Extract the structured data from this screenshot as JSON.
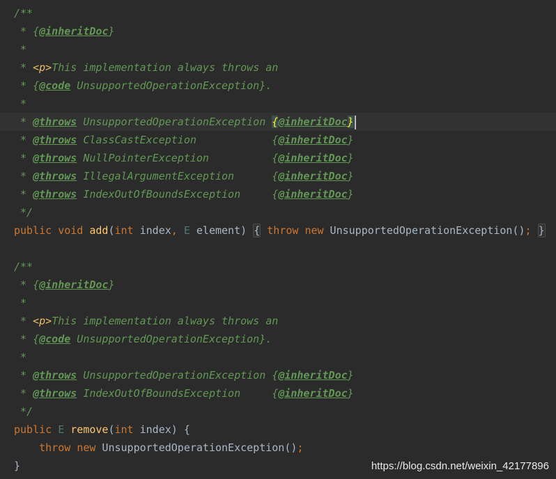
{
  "watermark": "https://blog.csdn.net/weixin_42177896",
  "code": {
    "l1": "/**",
    "l2": [
      " * {",
      "@inheritDoc",
      "}"
    ],
    "l3": " *",
    "l4": [
      " * ",
      "<p>",
      "This implementation always throws an"
    ],
    "l5": [
      " * {",
      "@code",
      " UnsupportedOperationException}."
    ],
    "l6": " *",
    "l7": [
      " * ",
      "@throws",
      " UnsupportedOperationException ",
      "{",
      "@inheritDoc",
      "}"
    ],
    "l8": [
      " * ",
      "@throws",
      " ClassCastException            {",
      "@inheritDoc",
      "}"
    ],
    "l9": [
      " * ",
      "@throws",
      " NullPointerException          {",
      "@inheritDoc",
      "}"
    ],
    "l10": [
      " * ",
      "@throws",
      " IllegalArgumentException      {",
      "@inheritDoc",
      "}"
    ],
    "l11": [
      " * ",
      "@throws",
      " IndexOutOfBoundsException     {",
      "@inheritDoc",
      "}"
    ],
    "l12": " */",
    "l13": [
      "public",
      " ",
      "void",
      " ",
      "add",
      "(",
      "int",
      " index",
      ",",
      " ",
      "E",
      " element)",
      " ",
      "{",
      " ",
      "throw",
      " ",
      "new",
      " UnsupportedOperationException()",
      ";",
      " ",
      "}"
    ],
    "l14": "",
    "l15": "/**",
    "l16": [
      " * {",
      "@inheritDoc",
      "}"
    ],
    "l17": " *",
    "l18": [
      " * ",
      "<p>",
      "This implementation always throws an"
    ],
    "l19": [
      " * {",
      "@code",
      " UnsupportedOperationException}."
    ],
    "l20": " *",
    "l21": [
      " * ",
      "@throws",
      " UnsupportedOperationException {",
      "@inheritDoc",
      "}"
    ],
    "l22": [
      " * ",
      "@throws",
      " IndexOutOfBoundsException     {",
      "@inheritDoc",
      "}"
    ],
    "l23": " */",
    "l24": [
      "public",
      " ",
      "E",
      " ",
      "remove",
      "(",
      "int",
      " index) {"
    ],
    "l25": [
      "    ",
      "throw",
      " ",
      "new",
      " UnsupportedOperationException()",
      ";"
    ],
    "l26": "}"
  }
}
